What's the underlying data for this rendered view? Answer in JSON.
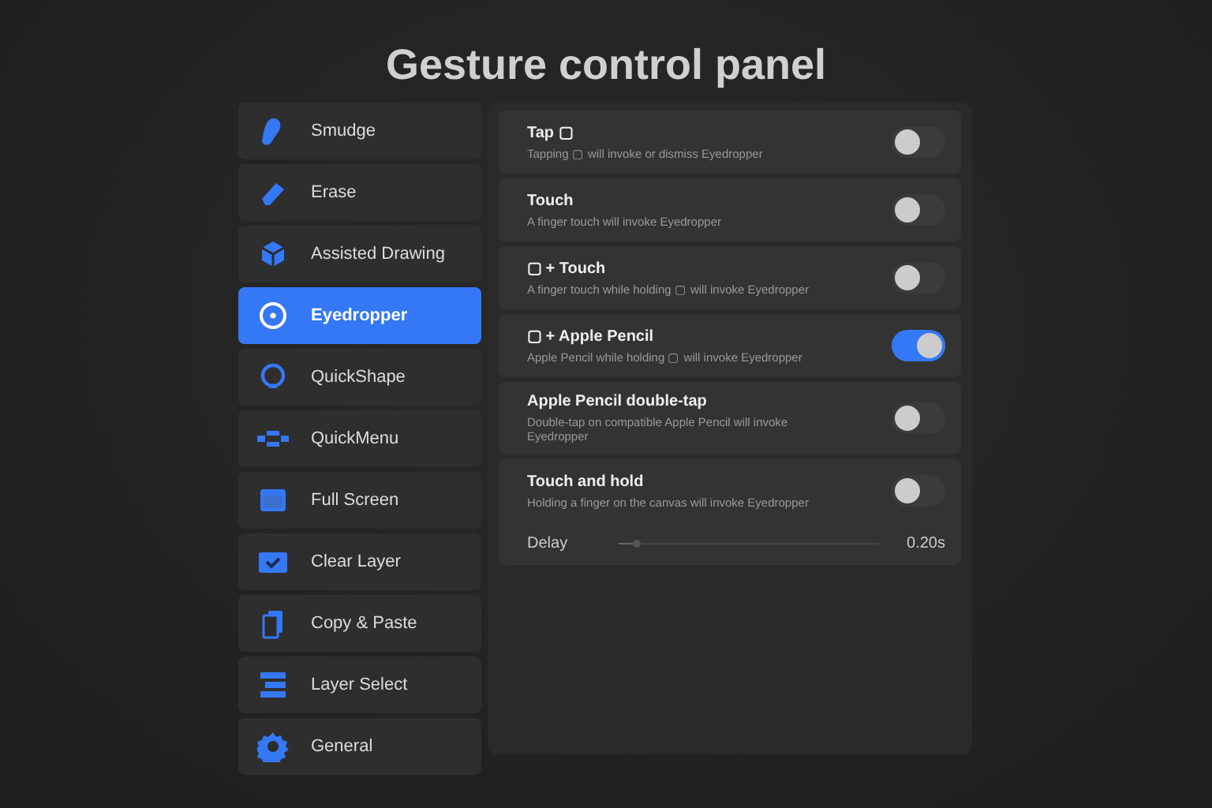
{
  "title": "Gesture control panel",
  "sidebar": {
    "items": [
      {
        "label": "Smudge",
        "selected": false
      },
      {
        "label": "Erase",
        "selected": false
      },
      {
        "label": "Assisted Drawing",
        "selected": false
      },
      {
        "label": "Eyedropper",
        "selected": true
      },
      {
        "label": "QuickShape",
        "selected": false
      },
      {
        "label": "QuickMenu",
        "selected": false
      },
      {
        "label": "Full Screen",
        "selected": false
      },
      {
        "label": "Clear Layer",
        "selected": false
      },
      {
        "label": "Copy & Paste",
        "selected": false
      },
      {
        "label": "Layer Select",
        "selected": false
      },
      {
        "label": "General",
        "selected": false
      }
    ]
  },
  "settings": [
    {
      "title": "Tap ▢",
      "description": "Tapping ▢ will invoke or dismiss Eyedropper",
      "on": false
    },
    {
      "title": "Touch",
      "description": "A finger touch will invoke Eyedropper",
      "on": false
    },
    {
      "title": "▢ + Touch",
      "description": "A finger touch while holding ▢ will invoke Eyedropper",
      "on": false
    },
    {
      "title": "▢ + Apple Pencil",
      "description": "Apple Pencil while holding ▢ will invoke Eyedropper",
      "on": true
    },
    {
      "title": "Apple Pencil double-tap",
      "description": "Double-tap on compatible Apple Pencil will invoke Eyedropper",
      "on": false
    },
    {
      "title": "Touch and hold",
      "description": "Holding a finger on the canvas will invoke Eyedropper",
      "on": false,
      "delay": {
        "label": "Delay",
        "level": 0.07,
        "reading": "0.20s"
      }
    }
  ]
}
